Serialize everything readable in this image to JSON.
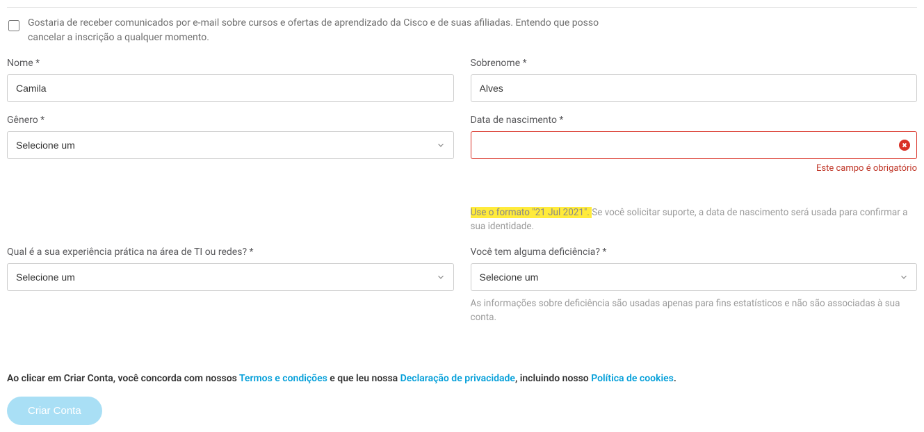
{
  "consent": {
    "label": "Gostaria de receber comunicados por e-mail sobre cursos e ofertas de aprendizado da Cisco e de suas afiliadas. Entendo que posso cancelar a inscrição a qualquer momento."
  },
  "fields": {
    "firstName": {
      "label": "Nome *",
      "value": "Camila"
    },
    "lastName": {
      "label": "Sobrenome *",
      "value": "Alves"
    },
    "gender": {
      "label": "Gênero *",
      "placeholder": "Selecione um"
    },
    "dob": {
      "label": "Data de nascimento *",
      "value": "",
      "error": "Este campo é obrigatório",
      "highlight": "Use o formato \"21 Jul 2021\". ",
      "helper": "Se você solicitar suporte, a data de nascimento será usada para confirmar a sua identidade."
    },
    "experience": {
      "label": "Qual é a sua experiência prática na área de TI ou redes? *",
      "placeholder": "Selecione um"
    },
    "disability": {
      "label": "Você tem alguma deficiência? *",
      "placeholder": "Selecione um",
      "helper": "As informações sobre deficiência são usadas apenas para fins estatísticos e não são associadas à sua conta."
    }
  },
  "agreement": {
    "prefix": "Ao clicar em Criar Conta, você concorda com nossos ",
    "terms": "Termos e condições",
    "mid1": " e que leu nossa ",
    "privacy": "Declaração de privacidade",
    "mid2": ", incluindo nosso ",
    "cookies": "Política de cookies",
    "suffix": "."
  },
  "submit": {
    "label": "Criar Conta"
  }
}
